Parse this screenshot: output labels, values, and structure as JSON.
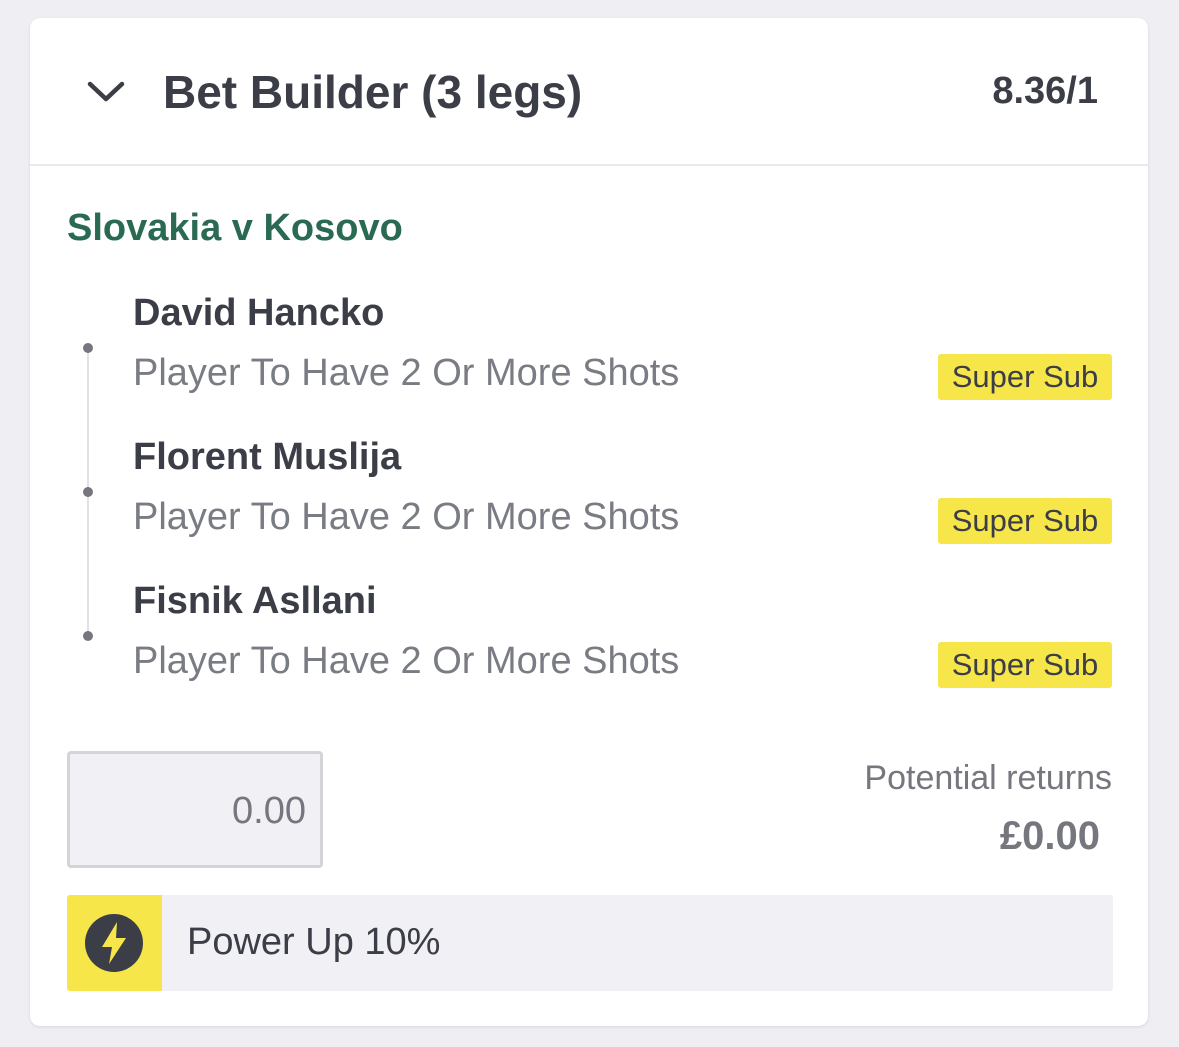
{
  "bet": {
    "title": "Bet Builder (3 legs)",
    "odds": "8.36/1",
    "match": "Slovakia v Kosovo",
    "legs": [
      {
        "player": "David Hancko",
        "market": "Player To Have 2 Or More Shots",
        "badge": "Super Sub"
      },
      {
        "player": "Florent Muslija",
        "market": "Player To Have 2 Or More Shots",
        "badge": "Super Sub"
      },
      {
        "player": "Fisnik Asllani",
        "market": "Player To Have 2 Or More Shots",
        "badge": "Super Sub"
      }
    ]
  },
  "stake": {
    "value": "0.00"
  },
  "returns": {
    "label": "Potential returns",
    "value": "£0.00"
  },
  "powerup": {
    "label": "Power Up 10%",
    "icon": "lightning-bolt-icon"
  },
  "colors": {
    "accent_green": "#2a6a53",
    "badge_yellow": "#f6e64a",
    "text_dark": "#3b3d47",
    "text_muted": "#7a7c84",
    "background": "#efeff3"
  }
}
